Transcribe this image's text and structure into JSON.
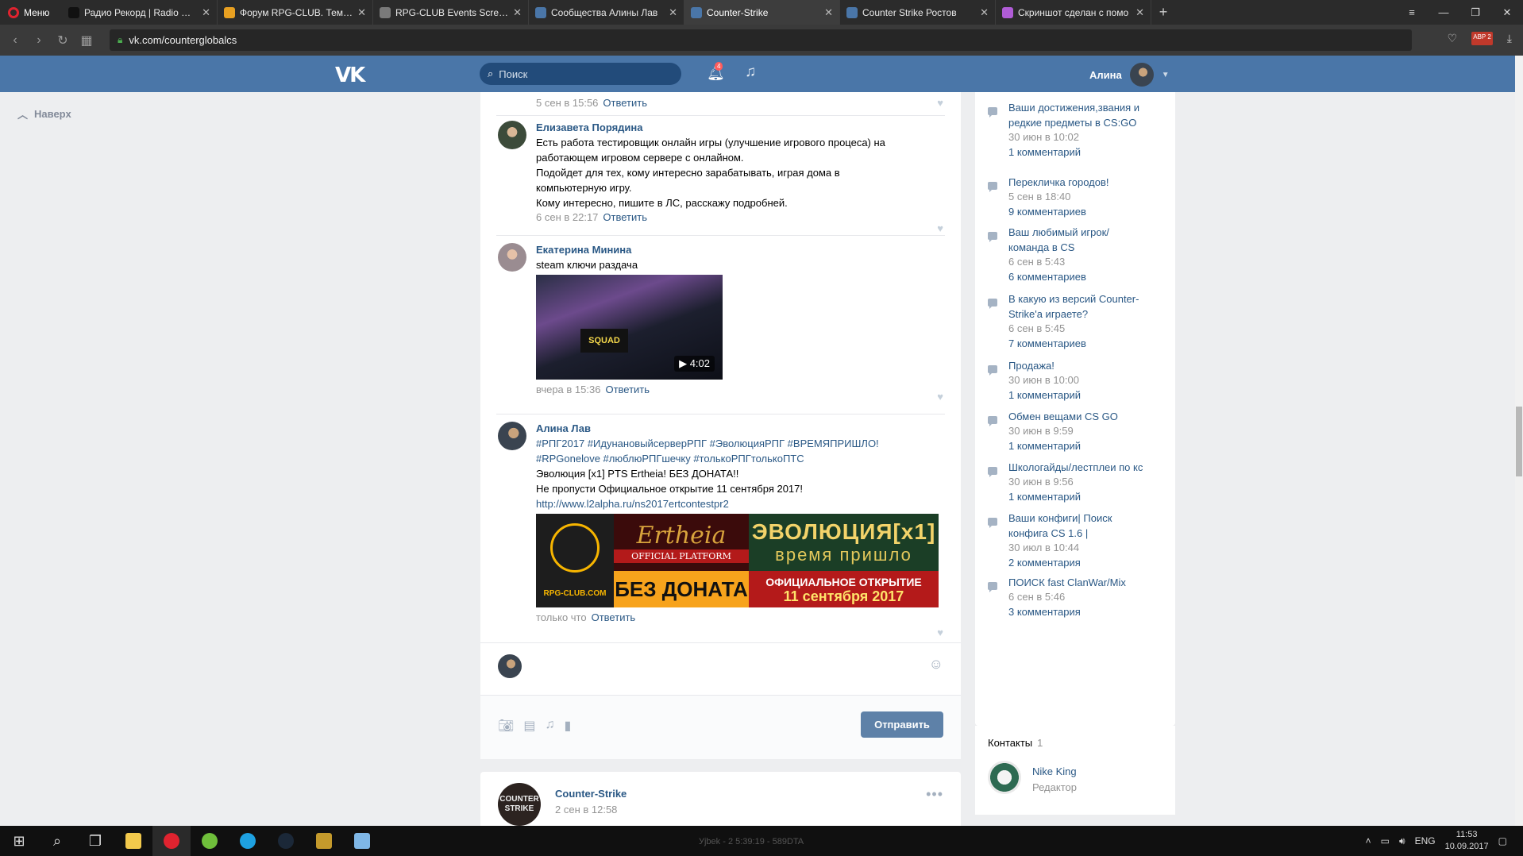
{
  "browser": {
    "menu_label": "Меню",
    "tabs": [
      {
        "title": "Радио Рекорд | Radio Rec",
        "color": "#111111",
        "active": false
      },
      {
        "title": "Форум RPG-CLUB. Тема: F",
        "color": "#e8a021",
        "active": false
      },
      {
        "title": "RPG-CLUB Events Screens",
        "color": "#7a7a7a",
        "active": false
      },
      {
        "title": "Сообщества Алины Лав",
        "color": "#4a76a8",
        "active": false
      },
      {
        "title": "Counter-Strike",
        "color": "#4a76a8",
        "active": true
      },
      {
        "title": "Counter Strike Ростов",
        "color": "#4a76a8",
        "active": false
      },
      {
        "title": "Скриншот сделан с помо",
        "color": "#b05cd6",
        "active": false
      }
    ],
    "url": "vk.com/counterglobalcs",
    "abp_label": "ABP",
    "abp_count": "2"
  },
  "header": {
    "search_placeholder": "Поиск",
    "notifications_count": "4",
    "user_name": "Алина"
  },
  "left": {
    "to_top": "Наверх"
  },
  "posts": [
    {
      "date": "5 сен в 15:56",
      "reply": "Ответить"
    },
    {
      "author": "Елизавета Порядина",
      "lines": [
        "Есть работа тестировщик онлайн игры (улучшение игрового процеса) на",
        "работающем игровом сервере с онлайном.",
        "Подойдет для тех, кому интересно зарабатывать, играя дома в",
        "компьютерную игру.",
        "Кому интересно, пишите в ЛС, расскажу подробней."
      ],
      "date": "6 сен в 22:17",
      "reply": "Ответить"
    },
    {
      "author": "Екатерина Минина",
      "text": "steam ключи раздача",
      "video_label": "SQUAD",
      "video_duration": "4:02",
      "date": "вчера в 15:36",
      "reply": "Ответить"
    },
    {
      "author": "Алина Лав",
      "tags_line1": "#РПГ2017 #ИдунановыйсерверРПГ #ЭволюцияРПГ #ВРЕМЯПРИШЛО!",
      "tags_line2": "#RPGonelove #люблюРПГшечку #толькоРПГтолькоПТС",
      "line1": "Эволюция [x1] PTS Ertheia! БЕЗ ДОНАТА!!",
      "line2": "Не пропусти Официальное открытие 11 сентября 2017!",
      "link": "http://www.l2alpha.ru/ns2017ertcontestpr2",
      "banner": {
        "site": "RPG-CLUB.COM",
        "logo": "Ertheia",
        "platform": "OFFICIAL PLATFORM",
        "no_donate": "БЕЗ ДОНАТА",
        "evolution": "ЭВОЛЮЦИЯ[x1]",
        "time": "время пришло",
        "opening": "ОФИЦИАЛЬНОЕ ОТКРЫТИЕ",
        "opening_date": "11 сентября 2017"
      },
      "date": "только что",
      "reply": "Ответить"
    }
  ],
  "comment": {
    "send_label": "Отправить"
  },
  "next_post": {
    "avatar_line1": "COUNTER",
    "avatar_line2": "STRIKE",
    "name": "Counter-Strike",
    "date": "2 сен в 12:58"
  },
  "topics": [
    {
      "title_lines": [
        "Ваши достижения,звания и",
        "редкие предметы в CS:GO"
      ],
      "date": "30 июн в 10:02",
      "count": "1 комментарий"
    },
    {
      "title_lines": [
        "Перекличка городов!"
      ],
      "date": "5 сен в 18:40",
      "count": "9 комментариев"
    },
    {
      "title_lines": [
        "Ваш любимый игрок/",
        "команда в CS"
      ],
      "date": "6 сен в 5:43",
      "count": "6 комментариев"
    },
    {
      "title_lines": [
        "В какую из версий Counter-",
        "Strike'а играете?"
      ],
      "date": "6 сен в 5:45",
      "count": "7 комментариев"
    },
    {
      "title_lines": [
        "Продажа!"
      ],
      "date": "30 июн в 10:00",
      "count": "1 комментарий"
    },
    {
      "title_lines": [
        "Обмен вещами CS GO"
      ],
      "date": "30 июн в 9:59",
      "count": "1 комментарий"
    },
    {
      "title_lines": [
        "Школогайды/лестплеи по кс"
      ],
      "date": "30 июн в 9:56",
      "count": "1 комментарий"
    },
    {
      "title_lines": [
        "Ваши конфиги| Поиск",
        "конфига CS 1.6 |"
      ],
      "date": "30 июл в 10:44",
      "count": "2 комментария"
    },
    {
      "title_lines": [
        "ПОИСК fast ClanWar/Mix"
      ],
      "date": "6 сен в 5:46",
      "count": "3 комментария"
    }
  ],
  "contacts": {
    "title": "Контакты",
    "count": "1",
    "name": "Nike King",
    "role": "Редактор"
  },
  "taskbar": {
    "lang": "ENG",
    "time": "11:53",
    "date": "10.09.2017",
    "status_text": "Уjbek - 2 5:39:19 - 589DTA"
  }
}
